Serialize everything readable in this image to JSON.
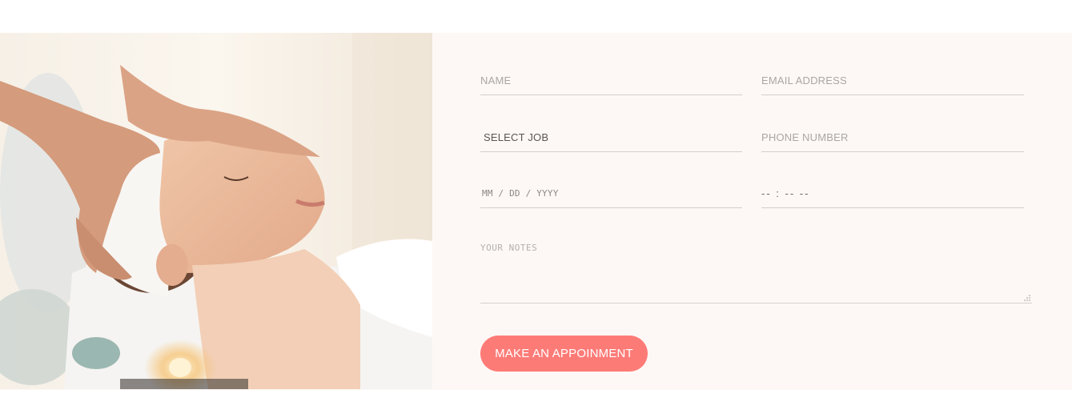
{
  "appointment_form": {
    "name_placeholder": "NAME",
    "email_placeholder": "EMAIL ADDRESS",
    "job_select_value": "SELECT JOB",
    "phone_placeholder": "PHONE NUMBER",
    "date_placeholder": "MM / DD / YYYY",
    "time_placeholder": "-- : --  --",
    "notes_placeholder": "YOUR NOTES",
    "submit_label": "MAKE AN APPOINMENT"
  },
  "colors": {
    "accent": "#fd7b77",
    "panel_background": "#fdf8f5",
    "field_underline": "#d4cfcc"
  },
  "hero_image": {
    "subject": "woman receiving facial massage at spa"
  }
}
